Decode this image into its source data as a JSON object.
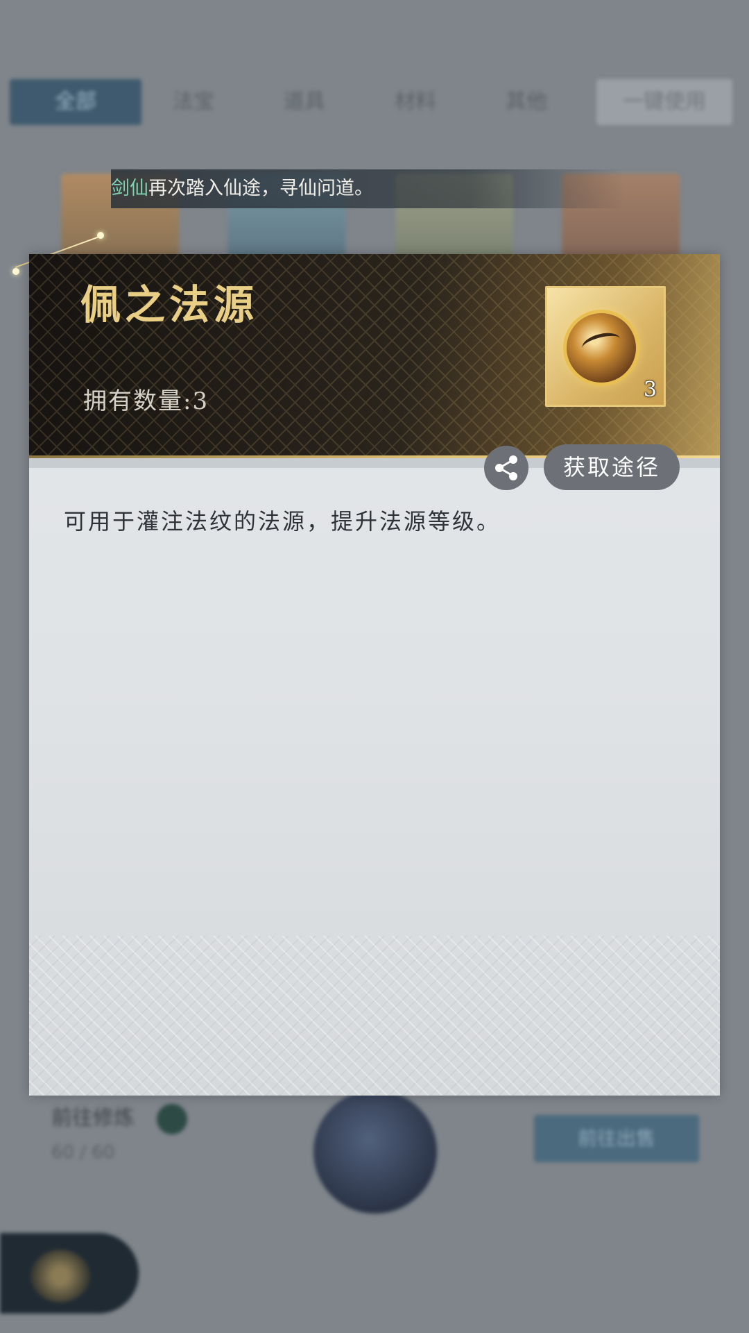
{
  "background": {
    "tabs": [
      "全部",
      "法宝",
      "道具",
      "材料",
      "其他",
      "一键使用"
    ],
    "bottom_left_title": "前往修炼",
    "bottom_left_sub": "60 / 60",
    "bottom_right_button": "前往出售"
  },
  "announcement": {
    "name": "剑仙",
    "message": "再次踏入仙途，寻仙问道。",
    "name_color": "#7fd3b0"
  },
  "item": {
    "name": "佩之法源",
    "owned_label": "拥有数量:3",
    "icon_count": "3",
    "icon": "golden-orb-icon",
    "description": "可用于灌注法纹的法源，提升法源等级。",
    "title_color": "#e9cf86"
  },
  "actions": {
    "share_icon": "share-icon",
    "source_label": "获取途径"
  }
}
